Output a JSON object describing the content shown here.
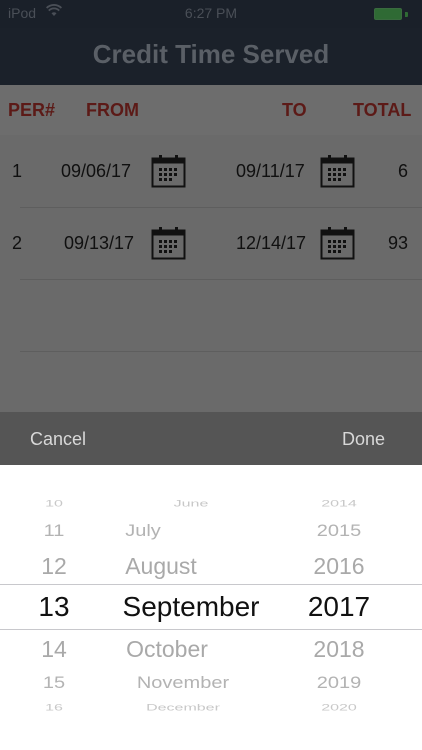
{
  "status_bar": {
    "carrier": "iPod",
    "time": "6:27 PM",
    "battery_color": "#2f6a34"
  },
  "nav": {
    "title": "Credit Time Served"
  },
  "table": {
    "headers": {
      "per": "PER#",
      "from": "FROM",
      "to": "TO",
      "total": "TOTAL"
    },
    "header_color": "#5c1a17",
    "rows": [
      {
        "per": "1",
        "from": "09/06/17",
        "to": "09/11/17",
        "total": "6"
      },
      {
        "per": "2",
        "from": "09/13/17",
        "to": "12/14/17",
        "total": "93"
      }
    ]
  },
  "toolbar": {
    "cancel_label": "Cancel",
    "done_label": "Done"
  },
  "date_picker": {
    "days": [
      "10",
      "11",
      "12",
      "13",
      "14",
      "15",
      "16"
    ],
    "months": [
      "June",
      "July",
      "August",
      "September",
      "October",
      "November",
      "December"
    ],
    "years": [
      "2014",
      "2015",
      "2016",
      "2017",
      "2018",
      "2019",
      "2020"
    ],
    "selected": {
      "day": "13",
      "month": "September",
      "year": "2017"
    }
  },
  "icons": {
    "calendar": "calendar-icon",
    "wifi": "wifi-icon",
    "battery": "battery-icon"
  }
}
